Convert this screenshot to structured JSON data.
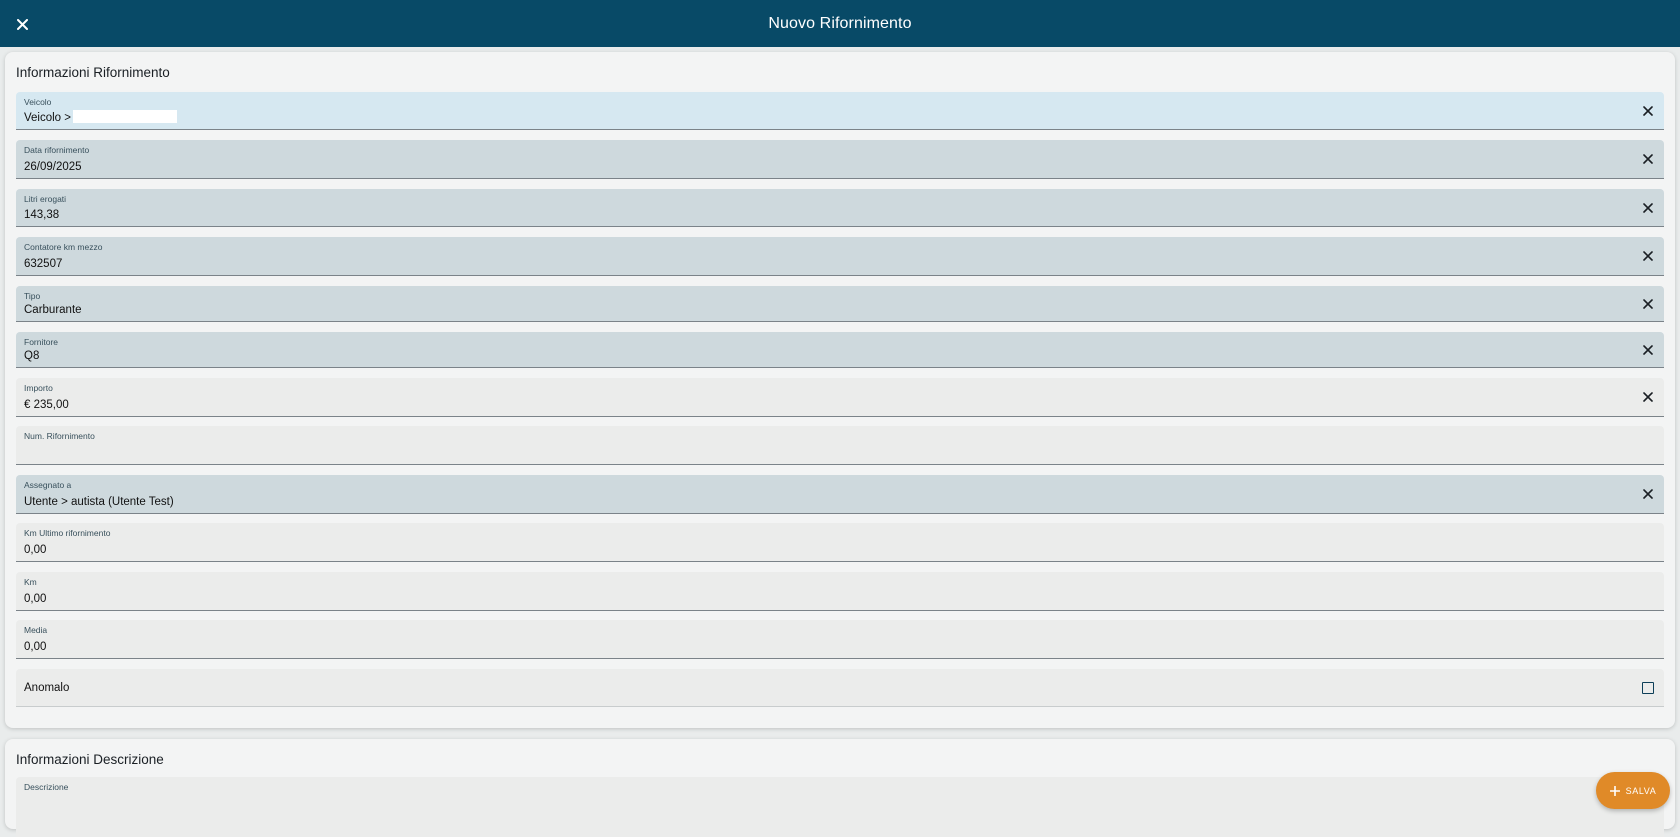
{
  "header": {
    "title": "Nuovo Rifornimento",
    "close_icon": "close-icon"
  },
  "section_rifornimento": {
    "title": "Informazioni Rifornimento",
    "fields": {
      "veicolo": {
        "label": "Veicolo",
        "value": "Veicolo >"
      },
      "data": {
        "label": "Data rifornimento",
        "value": "26/09/2025"
      },
      "litri": {
        "label": "Litri erogati",
        "value": "143,38"
      },
      "contatore": {
        "label": "Contatore km mezzo",
        "value": "632507"
      },
      "tipo": {
        "label": "Tipo",
        "value": "Carburante"
      },
      "fornitore": {
        "label": "Fornitore",
        "value": "Q8"
      },
      "importo": {
        "label": "Importo",
        "value": "€ 235,00"
      },
      "num": {
        "label": "Num. Rifornimento",
        "value": ""
      },
      "assegnato": {
        "label": "Assegnato a",
        "value": "Utente > autista (Utente Test)"
      },
      "km_ultimo": {
        "label": "Km Ultimo rifornimento",
        "value": "0,00"
      },
      "km": {
        "label": "Km",
        "value": "0,00"
      },
      "media": {
        "label": "Media",
        "value": "0,00"
      },
      "anomalo": {
        "label": "Anomalo",
        "checked": false
      }
    }
  },
  "section_descrizione": {
    "title": "Informazioni Descrizione",
    "descrizione_label": "Descrizione"
  },
  "fab": {
    "label": "SALVA",
    "icon": "plus-icon"
  },
  "colors": {
    "appbar": "#084a67",
    "field_filled": "#ced9dd",
    "field_active": "#d6e8f1",
    "field_empty": "#ebeceb",
    "fab": "#e08a28"
  }
}
